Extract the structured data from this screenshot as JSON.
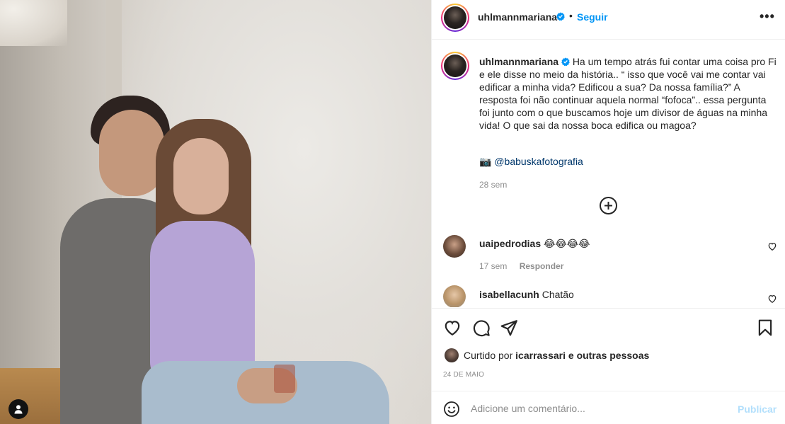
{
  "post": {
    "author": "uhlmannmariana",
    "follow_label": "Seguir",
    "dot": "•",
    "more_label": "•••",
    "caption": "Ha um tempo atrás fui contar uma coisa pro Fi e ele disse no meio da história.. “ isso que você vai me contar vai edificar a minha vida? Edificou a sua? Da nossa família?” A resposta foi não continuar aquela normal “fofoca”.. essa pergunta foi junto com o que buscamos hoje um divisor de águas na minha vida! O que sai da nossa boca edifica ou magoa?",
    "credit_icon": "📷",
    "credit_mention": "@babuskafotografia",
    "caption_time": "28 sem",
    "likes_prefix": "Curtido por",
    "likes_user": "icarrassari",
    "likes_suffix": "e outras pessoas",
    "date": "24 DE MAIO"
  },
  "comments": [
    {
      "user": "uaipedrodias",
      "text": "😂😂😂😂",
      "time": "17 sem",
      "reply_label": "Responder"
    },
    {
      "user": "isabellacunh",
      "text": "Chatão"
    }
  ],
  "composer": {
    "placeholder": "Adicione um comentário...",
    "publish_label": "Publicar"
  },
  "icons": {
    "verified": "verified-badge-icon",
    "more": "more-options-icon",
    "load_more": "plus-circle-icon",
    "like": "heart-icon",
    "comment": "comment-bubble-icon",
    "share": "paper-plane-icon",
    "save": "bookmark-icon",
    "emoji": "emoji-smile-icon",
    "tag": "user-tag-icon"
  },
  "colors": {
    "accent": "#0095f6",
    "mention": "#00376b",
    "muted": "#8e8e8e",
    "publish_disabled": "#b2dffc"
  }
}
